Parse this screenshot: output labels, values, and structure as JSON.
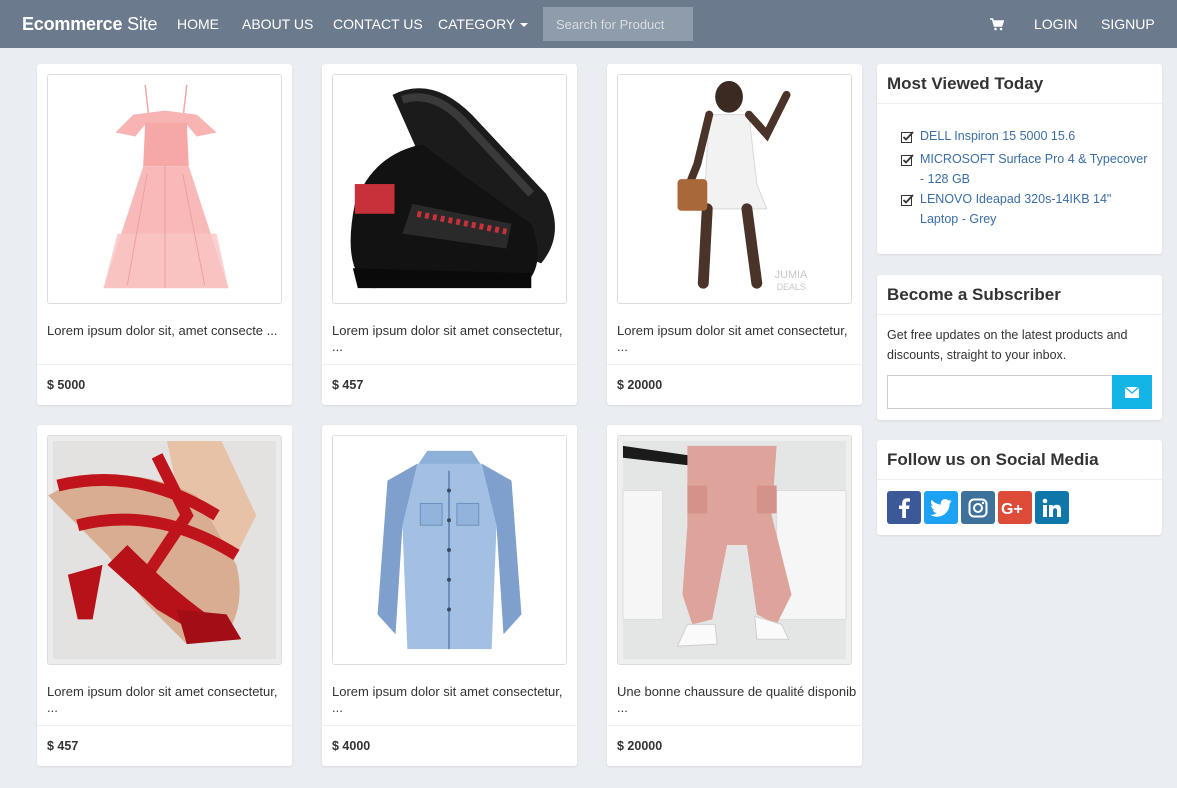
{
  "navbar": {
    "brand_bold": "Ecommerce",
    "brand_light": " Site",
    "links": [
      "HOME",
      "ABOUT US",
      "CONTACT US",
      "CATEGORY"
    ],
    "search_placeholder": "Search for Product",
    "login": "LOGIN",
    "signup": "SIGNUP",
    "cart_icon": "shopping-cart-icon"
  },
  "products": [
    {
      "title": "Lorem ipsum dolor sit, amet consecte ...",
      "price": "$ 5000",
      "image": "pink-dress"
    },
    {
      "title": "Lorem ipsum dolor sit amet consectetur, ...",
      "price": "$ 457",
      "image": "black-sneaker"
    },
    {
      "title": "Lorem ipsum dolor sit amet consectetur, ...",
      "price": "$ 20000",
      "image": "white-romper"
    },
    {
      "title": "Lorem ipsum dolor sit amet consectetur, ...",
      "price": "$ 457",
      "image": "red-heels"
    },
    {
      "title": "Lorem ipsum dolor sit amet consectetur, ...",
      "price": "$ 4000",
      "image": "denim-shirt"
    },
    {
      "title": "Une bonne chaussure de qualité disponib ...",
      "price": "$ 20000",
      "image": "pink-cargo-pants"
    }
  ],
  "most_viewed": {
    "title": "Most Viewed Today",
    "items": [
      [
        "DELL Inspiron 15 5000 15.6"
      ],
      [
        "MICROSOFT Surface Pro 4 & Typecover",
        "- 128 GB"
      ],
      [
        "LENOVO Ideapad 320s-14IKB 14\"",
        "Laptop - Grey"
      ]
    ]
  },
  "subscribe": {
    "title": "Become a Subscriber",
    "text_lines": [
      "Get free updates on the latest products and",
      "discounts, straight to your inbox."
    ],
    "button_icon": "envelope-icon"
  },
  "social": {
    "title": "Follow us on Social Media",
    "networks": [
      {
        "name": "facebook",
        "label": "f",
        "color": "#3b5998"
      },
      {
        "name": "twitter",
        "label": "t",
        "color": "#1da1f2"
      },
      {
        "name": "instagram",
        "label": "ig",
        "color": "#3f729b"
      },
      {
        "name": "google-plus",
        "label": "G+",
        "color": "#dd4b39"
      },
      {
        "name": "linkedin",
        "label": "in",
        "color": "#0e76a8"
      }
    ]
  },
  "colors": {
    "navbar": "#6b7b8d",
    "search_bg": "#8f9cab",
    "page_bg": "#eaedf2",
    "link": "#3a6ea5",
    "subscribe_btn": "#12b5e6"
  }
}
